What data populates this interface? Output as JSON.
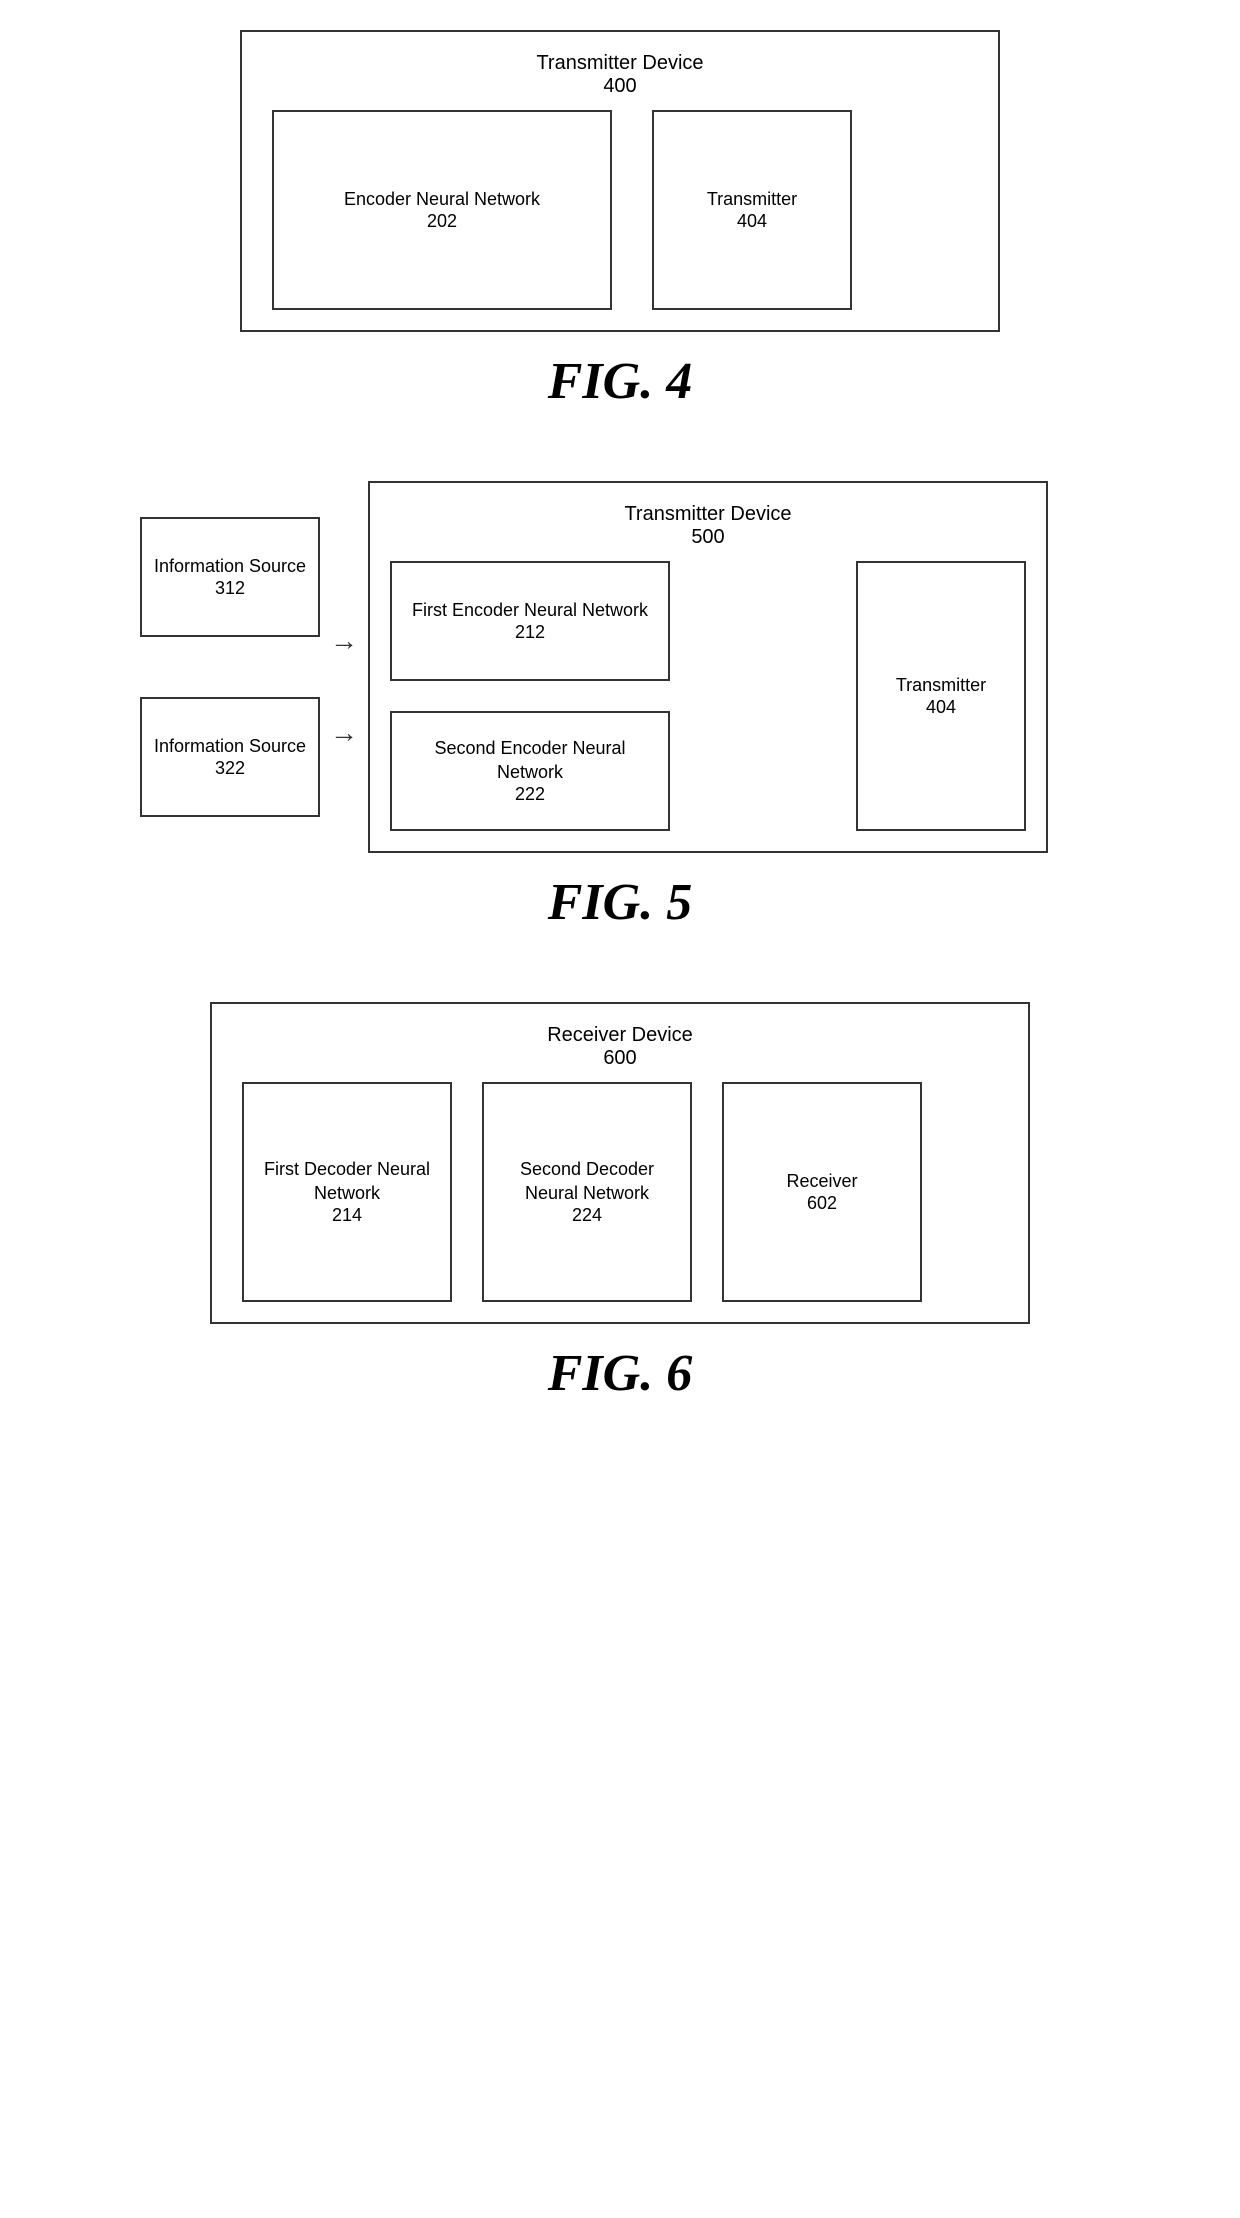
{
  "fig4": {
    "outer_title": "Transmitter Device",
    "outer_number": "400",
    "encoder_label": "Encoder Neural Network",
    "encoder_number": "202",
    "transmitter_label": "Transmitter",
    "transmitter_number": "404",
    "fig_label": "FIG. 4"
  },
  "fig5": {
    "outer_title": "Transmitter Device",
    "outer_number": "500",
    "source1_label": "Information Source",
    "source1_number": "312",
    "source2_label": "Information Source",
    "source2_number": "322",
    "encoder1_label": "First Encoder Neural Network",
    "encoder1_number": "212",
    "encoder2_label": "Second Encoder Neural Network",
    "encoder2_number": "222",
    "transmitter_label": "Transmitter",
    "transmitter_number": "404",
    "fig_label": "FIG. 5"
  },
  "fig6": {
    "outer_title": "Receiver Device",
    "outer_number": "600",
    "decoder1_label": "First Decoder Neural Network",
    "decoder1_number": "214",
    "decoder2_label": "Second Decoder Neural Network",
    "decoder2_number": "224",
    "receiver_label": "Receiver",
    "receiver_number": "602",
    "fig_label": "FIG. 6"
  }
}
